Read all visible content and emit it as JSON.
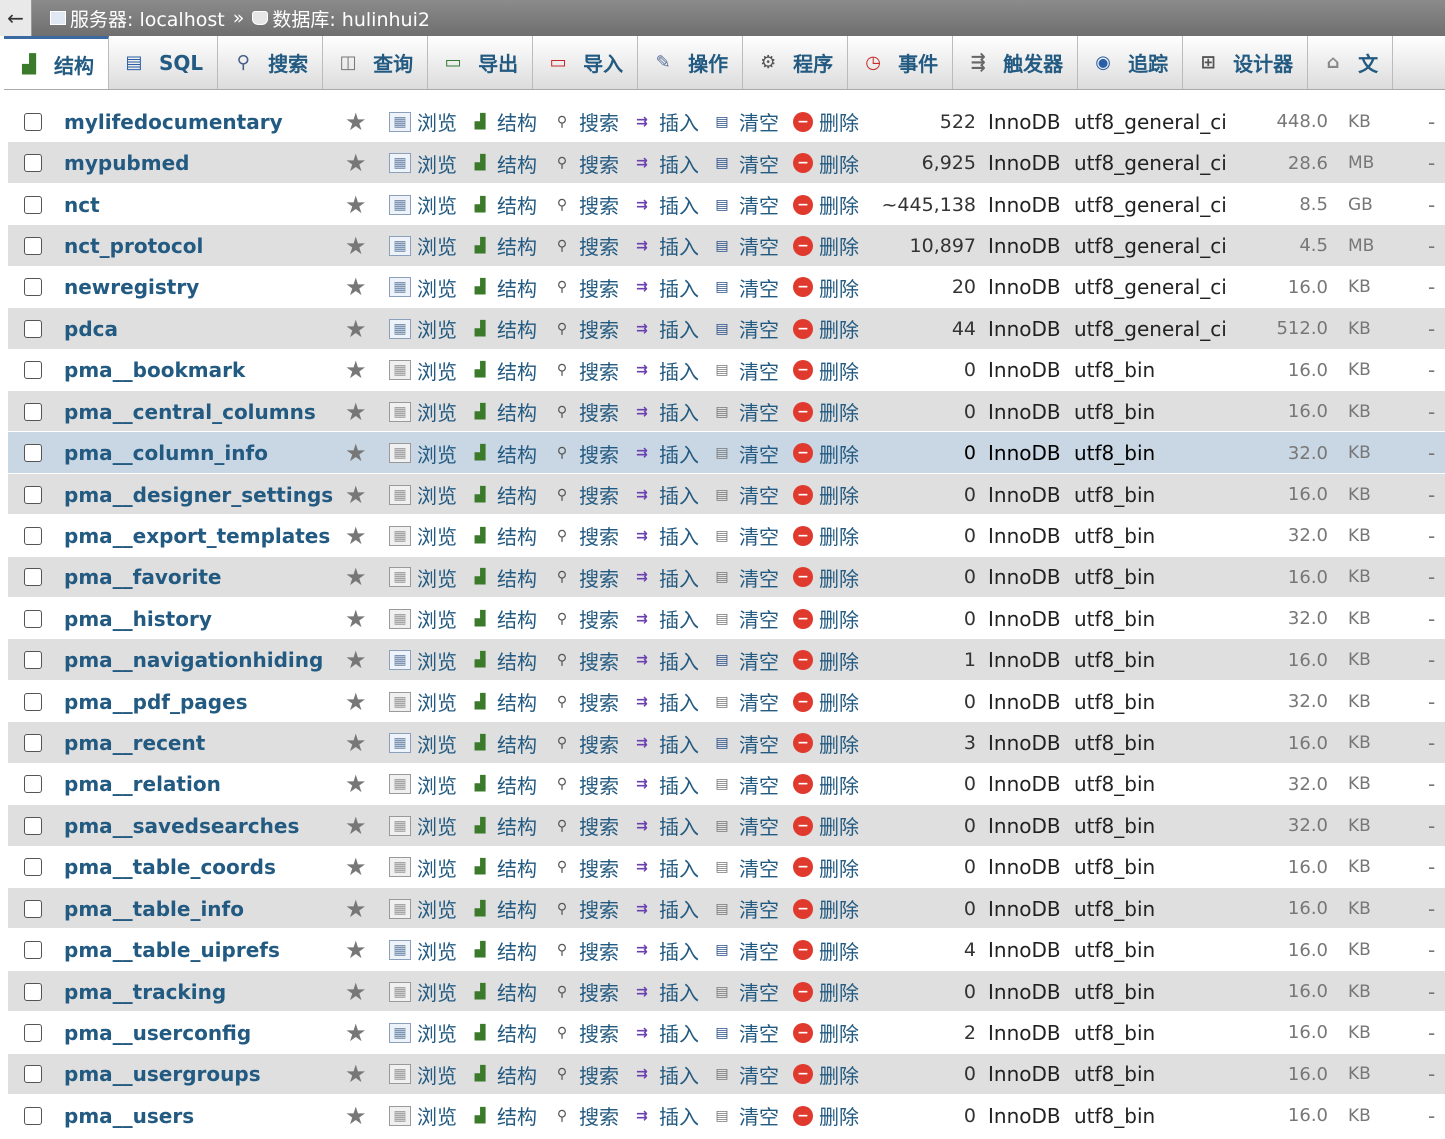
{
  "breadcrumb": {
    "back_label": "←",
    "server": "服务器: localhost",
    "separator": "»",
    "database": "数据库: hulinhui2"
  },
  "tabs": [
    {
      "label": "结构",
      "icon": "structure-icon",
      "active": true
    },
    {
      "label": "SQL",
      "icon": "sql-icon"
    },
    {
      "label": "搜索",
      "icon": "search-icon"
    },
    {
      "label": "查询",
      "icon": "query-icon"
    },
    {
      "label": "导出",
      "icon": "export-icon"
    },
    {
      "label": "导入",
      "icon": "import-icon"
    },
    {
      "label": "操作",
      "icon": "wrench-icon"
    },
    {
      "label": "程序",
      "icon": "routines-icon"
    },
    {
      "label": "事件",
      "icon": "clock-icon"
    },
    {
      "label": "触发器",
      "icon": "trigger-icon"
    },
    {
      "label": "追踪",
      "icon": "eye-icon"
    },
    {
      "label": "设计器",
      "icon": "designer-icon"
    },
    {
      "label": "文",
      "icon": "central-columns-icon"
    }
  ],
  "actions": {
    "browse": "浏览",
    "structure": "结构",
    "search": "搜索",
    "insert": "插入",
    "empty": "清空",
    "drop": "删除"
  },
  "tables": [
    {
      "name": "mylifedocumentary",
      "rows": "522",
      "engine": "InnoDB",
      "collation": "utf8_general_ci",
      "size": "448.0",
      "unit": "KB",
      "overhead": "-",
      "has_data": true
    },
    {
      "name": "mypubmed",
      "rows": "6,925",
      "engine": "InnoDB",
      "collation": "utf8_general_ci",
      "size": "28.6",
      "unit": "MB",
      "overhead": "-",
      "has_data": true
    },
    {
      "name": "nct",
      "rows": "~445,138",
      "engine": "InnoDB",
      "collation": "utf8_general_ci",
      "size": "8.5",
      "unit": "GB",
      "overhead": "-",
      "has_data": true
    },
    {
      "name": "nct_protocol",
      "rows": "10,897",
      "engine": "InnoDB",
      "collation": "utf8_general_ci",
      "size": "4.5",
      "unit": "MB",
      "overhead": "-",
      "has_data": true
    },
    {
      "name": "newregistry",
      "rows": "20",
      "engine": "InnoDB",
      "collation": "utf8_general_ci",
      "size": "16.0",
      "unit": "KB",
      "overhead": "-",
      "has_data": true
    },
    {
      "name": "pdca",
      "rows": "44",
      "engine": "InnoDB",
      "collation": "utf8_general_ci",
      "size": "512.0",
      "unit": "KB",
      "overhead": "-",
      "has_data": true
    },
    {
      "name": "pma__bookmark",
      "rows": "0",
      "engine": "InnoDB",
      "collation": "utf8_bin",
      "size": "16.0",
      "unit": "KB",
      "overhead": "-",
      "has_data": false
    },
    {
      "name": "pma__central_columns",
      "rows": "0",
      "engine": "InnoDB",
      "collation": "utf8_bin",
      "size": "16.0",
      "unit": "KB",
      "overhead": "-",
      "has_data": false
    },
    {
      "name": "pma__column_info",
      "rows": "0",
      "engine": "InnoDB",
      "collation": "utf8_bin",
      "size": "32.0",
      "unit": "KB",
      "overhead": "-",
      "has_data": false,
      "highlight": true
    },
    {
      "name": "pma__designer_settings",
      "rows": "0",
      "engine": "InnoDB",
      "collation": "utf8_bin",
      "size": "16.0",
      "unit": "KB",
      "overhead": "-",
      "has_data": false
    },
    {
      "name": "pma__export_templates",
      "rows": "0",
      "engine": "InnoDB",
      "collation": "utf8_bin",
      "size": "32.0",
      "unit": "KB",
      "overhead": "-",
      "has_data": false
    },
    {
      "name": "pma__favorite",
      "rows": "0",
      "engine": "InnoDB",
      "collation": "utf8_bin",
      "size": "16.0",
      "unit": "KB",
      "overhead": "-",
      "has_data": false
    },
    {
      "name": "pma__history",
      "rows": "0",
      "engine": "InnoDB",
      "collation": "utf8_bin",
      "size": "32.0",
      "unit": "KB",
      "overhead": "-",
      "has_data": false
    },
    {
      "name": "pma__navigationhiding",
      "rows": "1",
      "engine": "InnoDB",
      "collation": "utf8_bin",
      "size": "16.0",
      "unit": "KB",
      "overhead": "-",
      "has_data": true
    },
    {
      "name": "pma__pdf_pages",
      "rows": "0",
      "engine": "InnoDB",
      "collation": "utf8_bin",
      "size": "32.0",
      "unit": "KB",
      "overhead": "-",
      "has_data": false
    },
    {
      "name": "pma__recent",
      "rows": "3",
      "engine": "InnoDB",
      "collation": "utf8_bin",
      "size": "16.0",
      "unit": "KB",
      "overhead": "-",
      "has_data": true
    },
    {
      "name": "pma__relation",
      "rows": "0",
      "engine": "InnoDB",
      "collation": "utf8_bin",
      "size": "32.0",
      "unit": "KB",
      "overhead": "-",
      "has_data": false
    },
    {
      "name": "pma__savedsearches",
      "rows": "0",
      "engine": "InnoDB",
      "collation": "utf8_bin",
      "size": "32.0",
      "unit": "KB",
      "overhead": "-",
      "has_data": false
    },
    {
      "name": "pma__table_coords",
      "rows": "0",
      "engine": "InnoDB",
      "collation": "utf8_bin",
      "size": "16.0",
      "unit": "KB",
      "overhead": "-",
      "has_data": false
    },
    {
      "name": "pma__table_info",
      "rows": "0",
      "engine": "InnoDB",
      "collation": "utf8_bin",
      "size": "16.0",
      "unit": "KB",
      "overhead": "-",
      "has_data": false
    },
    {
      "name": "pma__table_uiprefs",
      "rows": "4",
      "engine": "InnoDB",
      "collation": "utf8_bin",
      "size": "16.0",
      "unit": "KB",
      "overhead": "-",
      "has_data": true
    },
    {
      "name": "pma__tracking",
      "rows": "0",
      "engine": "InnoDB",
      "collation": "utf8_bin",
      "size": "16.0",
      "unit": "KB",
      "overhead": "-",
      "has_data": false
    },
    {
      "name": "pma__userconfig",
      "rows": "2",
      "engine": "InnoDB",
      "collation": "utf8_bin",
      "size": "16.0",
      "unit": "KB",
      "overhead": "-",
      "has_data": true
    },
    {
      "name": "pma__usergroups",
      "rows": "0",
      "engine": "InnoDB",
      "collation": "utf8_bin",
      "size": "16.0",
      "unit": "KB",
      "overhead": "-",
      "has_data": false
    },
    {
      "name": "pma__users",
      "rows": "0",
      "engine": "InnoDB",
      "collation": "utf8_bin",
      "size": "16.0",
      "unit": "KB",
      "overhead": "-",
      "has_data": false
    }
  ]
}
